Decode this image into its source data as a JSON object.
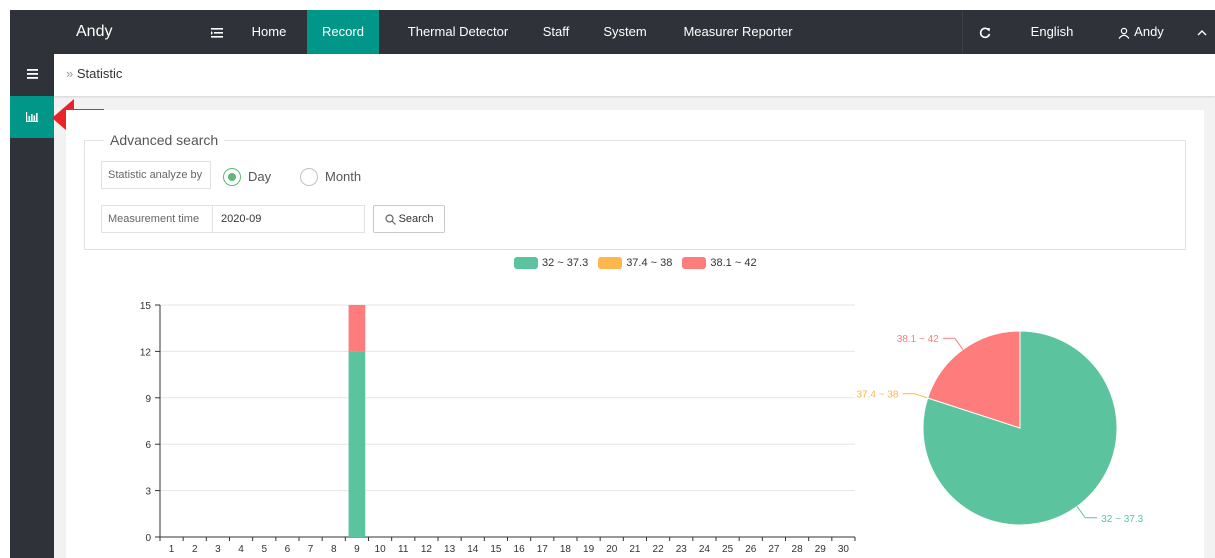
{
  "topbar": {
    "brand": "Andy",
    "nav": [
      "Home",
      "Record",
      "Thermal Detector",
      "Staff",
      "System",
      "Measurer Reporter"
    ],
    "active": "Record",
    "language": "English",
    "user": "Andy"
  },
  "breadcrumb": {
    "current": "Statistic"
  },
  "search": {
    "legend": "Advanced search",
    "analyze_label": "Statistic analyze by",
    "options": [
      "Day",
      "Month"
    ],
    "selected": "Day",
    "time_label": "Measurement time",
    "time_value": "2020-09",
    "button": "Search"
  },
  "colors": {
    "dark": "#2f3238",
    "accent": "#009688",
    "green": "#5bc49f",
    "orange": "#feb64d",
    "red": "#ff7c7c"
  },
  "chart_data": [
    {
      "type": "bar",
      "stacked": true,
      "categories": [
        "1",
        "2",
        "3",
        "4",
        "5",
        "6",
        "7",
        "8",
        "9",
        "10",
        "11",
        "12",
        "13",
        "14",
        "15",
        "16",
        "17",
        "18",
        "19",
        "20",
        "21",
        "22",
        "23",
        "24",
        "25",
        "26",
        "27",
        "28",
        "29",
        "30"
      ],
      "series": [
        {
          "name": "32 ~ 37.3",
          "color": "#5bc49f",
          "values": [
            0,
            0,
            0,
            0,
            0,
            0,
            0,
            0,
            12,
            0,
            0,
            0,
            0,
            0,
            0,
            0,
            0,
            0,
            0,
            0,
            0,
            0,
            0,
            0,
            0,
            0,
            0,
            0,
            0,
            0
          ]
        },
        {
          "name": "37.4 ~ 38",
          "color": "#feb64d",
          "values": [
            0,
            0,
            0,
            0,
            0,
            0,
            0,
            0,
            0,
            0,
            0,
            0,
            0,
            0,
            0,
            0,
            0,
            0,
            0,
            0,
            0,
            0,
            0,
            0,
            0,
            0,
            0,
            0,
            0,
            0
          ]
        },
        {
          "name": "38.1 ~ 42",
          "color": "#ff7c7c",
          "values": [
            0,
            0,
            0,
            0,
            0,
            0,
            0,
            0,
            3,
            0,
            0,
            0,
            0,
            0,
            0,
            0,
            0,
            0,
            0,
            0,
            0,
            0,
            0,
            0,
            0,
            0,
            0,
            0,
            0,
            0
          ]
        }
      ],
      "yticks": [
        0,
        3,
        6,
        9,
        12,
        15
      ],
      "ylim": [
        0,
        15
      ],
      "grid": true,
      "legend": "top-center"
    },
    {
      "type": "pie",
      "slices": [
        {
          "label": "32 ~ 37.3",
          "value": 12,
          "color": "#5bc49f"
        },
        {
          "label": "37.4 ~ 38",
          "value": 0,
          "color": "#feb64d"
        },
        {
          "label": "38.1 ~ 42",
          "value": 3,
          "color": "#ff7c7c"
        }
      ]
    }
  ]
}
